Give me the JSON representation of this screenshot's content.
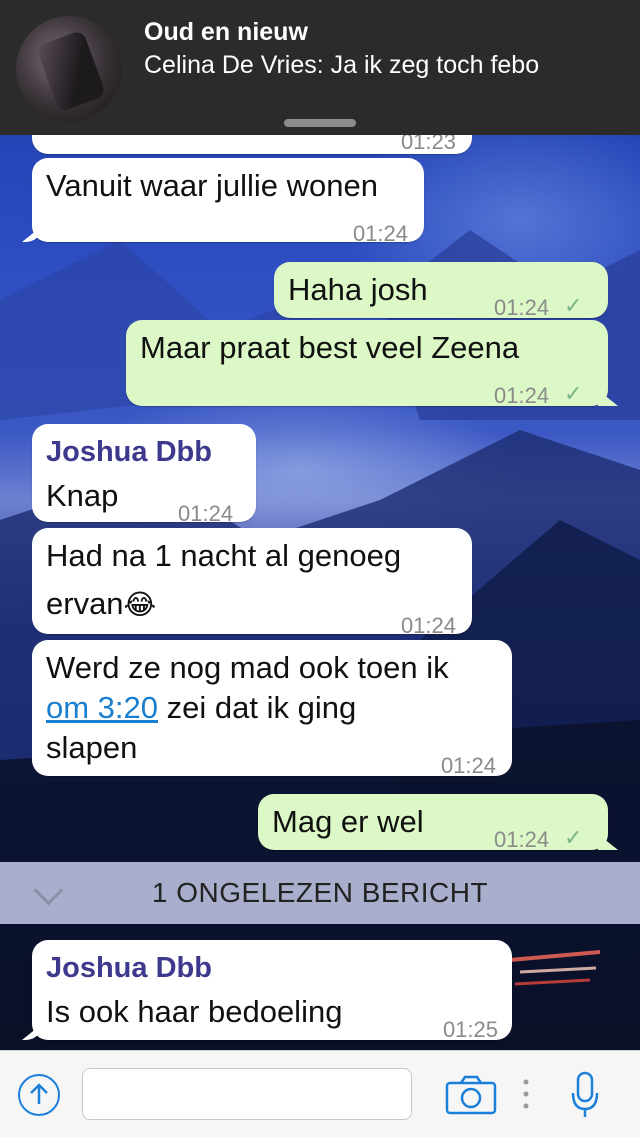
{
  "notification": {
    "title": "Oud en nieuw",
    "body": "Celina De Vries: Ja ik zeg toch febo"
  },
  "messages": [
    {
      "id": "m0",
      "direction": "in",
      "text": "Vanuit waar jullie wonen",
      "time": "01:24"
    },
    {
      "id": "m1",
      "direction": "out",
      "text": "Haha josh",
      "time": "01:24",
      "status_icon": "read-check"
    },
    {
      "id": "m2",
      "direction": "out",
      "text": "Maar praat best veel Zeena",
      "time": "01:24",
      "status_icon": "read-check"
    },
    {
      "id": "m3",
      "direction": "in",
      "sender": "Joshua Dbb",
      "text": "Knap",
      "time": "01:24"
    },
    {
      "id": "m4",
      "direction": "in",
      "line1": "Had na 1 nacht al genoeg",
      "line2": "ervan",
      "emoji": "😂",
      "time": "01:24"
    },
    {
      "id": "m5",
      "direction": "in",
      "line1": "Werd ze nog mad ook toen ik",
      "link": "om 3:20",
      "line2_rest": " zei dat ik ging",
      "line3": "slapen",
      "time": "01:24"
    },
    {
      "id": "m6",
      "direction": "out",
      "text": "Mag er wel",
      "time": "01:24",
      "status_icon": "read-check"
    },
    {
      "id": "m7",
      "direction": "in",
      "sender": "Joshua Dbb",
      "text": "Is ook haar bedoeling",
      "time": "01:25"
    }
  ],
  "partial_bubble": {
    "time": "01:23"
  },
  "unread_divider": {
    "label": "1 ONGELEZEN BERICHT"
  },
  "input_bar": {
    "placeholder": "",
    "icons": [
      "upload-icon",
      "camera-icon",
      "more-dots-icon",
      "microphone-icon"
    ],
    "accent_color": "#1c7fd9"
  },
  "colors": {
    "outgoing_bubble": "#dcf8c6",
    "incoming_bubble": "#ffffff",
    "sender_name": "#3d3a8e",
    "link": "#1b7fd0"
  }
}
